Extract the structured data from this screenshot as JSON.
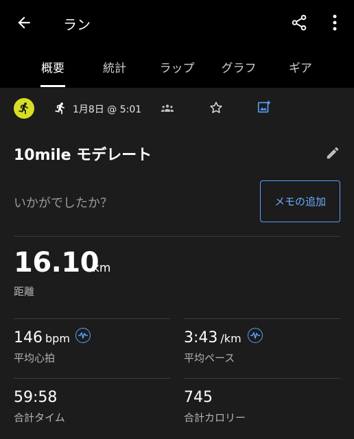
{
  "header": {
    "title": "ラン",
    "back_icon": "arrow-left-icon",
    "share_icon": "share-icon",
    "more_icon": "more-vertical-icon"
  },
  "tabs": [
    {
      "label": "概要",
      "active": true
    },
    {
      "label": "統計",
      "active": false
    },
    {
      "label": "ラップ",
      "active": false
    },
    {
      "label": "グラフ",
      "active": false
    },
    {
      "label": "ギア",
      "active": false
    }
  ],
  "meta": {
    "activity_icon": "running-person-icon",
    "activity_color": "#d6df23",
    "date": "1月8日 @ 5:01",
    "group_icon": "group-icon",
    "star_icon": "star-outline-icon",
    "photo_icon": "add-photo-icon"
  },
  "activity": {
    "name": "10mile モデレート",
    "edit_icon": "pencil-icon"
  },
  "feedback": {
    "prompt": "いかがでしたか？",
    "memo_button": "メモの追加"
  },
  "stats": {
    "distance": {
      "value": "16.10",
      "unit": "km",
      "label": "距離"
    },
    "avg_hr": {
      "value": "146",
      "unit": "bpm",
      "label": "平均心拍"
    },
    "avg_pace": {
      "value": "3:43",
      "unit": "/km",
      "label": "平均ペース"
    },
    "total_time": {
      "value": "59:58",
      "label": "合計タイム"
    },
    "calories": {
      "value": "745",
      "label": "合計カロリー"
    }
  },
  "colors": {
    "accent": "#5aa0ff",
    "background": "#1c1c1c",
    "header_bg": "#000000"
  }
}
